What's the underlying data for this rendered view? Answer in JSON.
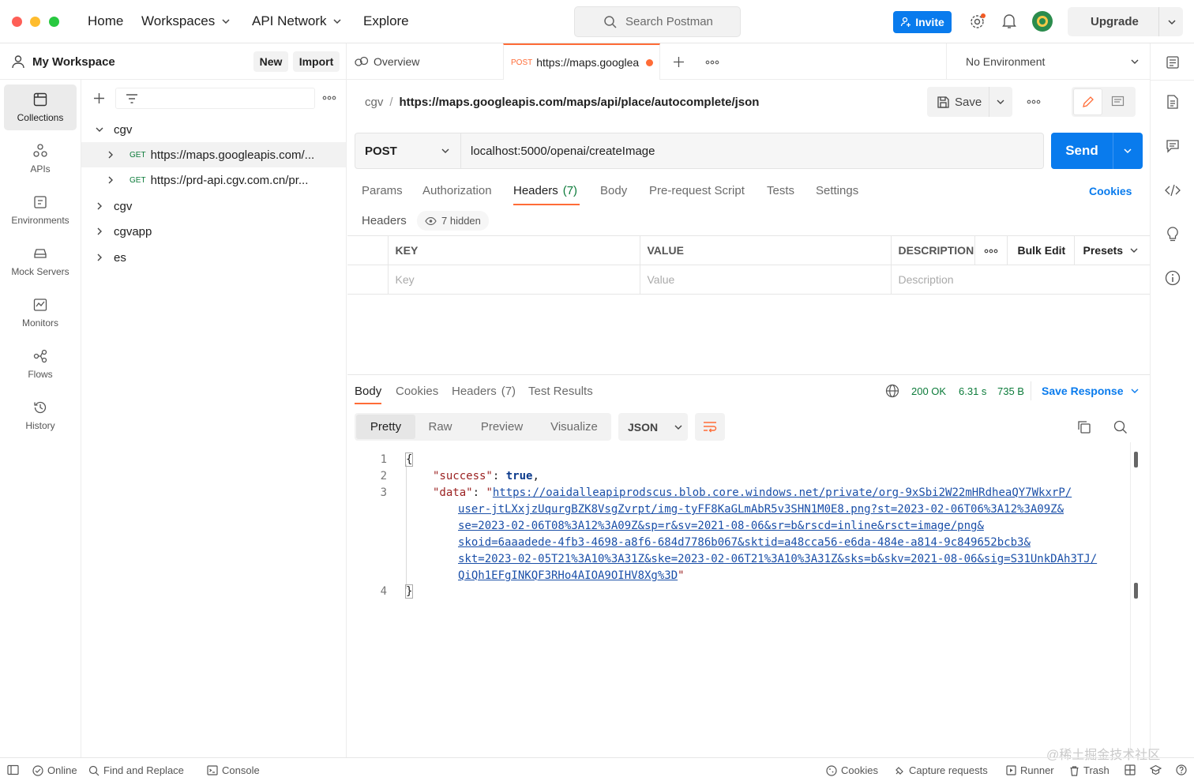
{
  "colors": {
    "accent": "#097bed",
    "brand": "#ff6c37",
    "success": "#0c7b3a",
    "link": "#1a4fa8"
  },
  "topnav": {
    "home": "Home",
    "workspaces": "Workspaces",
    "api_network": "API Network",
    "explore": "Explore",
    "search_placeholder": "Search Postman",
    "invite": "Invite",
    "upgrade": "Upgrade"
  },
  "workspace": {
    "name": "My Workspace",
    "new_label": "New",
    "import_label": "Import"
  },
  "rail": [
    {
      "label": "Collections",
      "icon": "collections-icon"
    },
    {
      "label": "APIs",
      "icon": "apis-icon"
    },
    {
      "label": "Environments",
      "icon": "environments-icon"
    },
    {
      "label": "Mock Servers",
      "icon": "mock-servers-icon"
    },
    {
      "label": "Monitors",
      "icon": "monitors-icon"
    },
    {
      "label": "Flows",
      "icon": "flows-icon"
    },
    {
      "label": "History",
      "icon": "history-icon"
    }
  ],
  "tree": [
    {
      "label": "cgv",
      "expanded": true
    },
    {
      "method": "GET",
      "label": "https://maps.googleapis.com/..."
    },
    {
      "method": "GET",
      "label": "https://prd-api.cgv.com.cn/pr..."
    },
    {
      "label": "cgv"
    },
    {
      "label": "cgvapp"
    },
    {
      "label": "es"
    }
  ],
  "tabs": {
    "overview": "Overview",
    "active_method": "POST",
    "active_title": "https://maps.googlea",
    "environment": "No Environment"
  },
  "breadcrumb": {
    "collection": "cgv",
    "separator": "/",
    "request": "https://maps.googleapis.com/maps/api/place/autocomplete/json"
  },
  "toolbar": {
    "save": "Save"
  },
  "request": {
    "method": "POST",
    "url": "localhost:5000/openai/createImage",
    "send": "Send",
    "tabs": [
      "Params",
      "Authorization",
      "Headers",
      "Body",
      "Pre-request Script",
      "Tests",
      "Settings"
    ],
    "headers_count": "(7)",
    "cookies": "Cookies",
    "headers_label": "Headers",
    "hidden": "7 hidden"
  },
  "headers_table": {
    "columns": [
      "KEY",
      "VALUE",
      "DESCRIPTION"
    ],
    "bulk_edit": "Bulk Edit",
    "presets": "Presets",
    "placeholders": [
      "Key",
      "Value",
      "Description"
    ]
  },
  "response": {
    "tabs": [
      "Body",
      "Cookies",
      "Headers",
      "Test Results"
    ],
    "headers_count": "(7)",
    "status": "200 OK",
    "time": "6.31 s",
    "size": "735 B",
    "save_response": "Save Response",
    "modes": [
      "Pretty",
      "Raw",
      "Preview",
      "Visualize"
    ],
    "format": "JSON",
    "code": {
      "line_numbers": [
        "1",
        "2",
        "3",
        "4"
      ],
      "open_brace": "{",
      "close_brace": "}",
      "success_key": "\"success\"",
      "success_value": "true",
      "data_key": "\"data\"",
      "url_lines": [
        "https://oaidalleapiprodscus.blob.core.windows.net/private/org-9xSbi2W22mHRdheaQY7WkxrP/",
        "user-jtLXxjzUqurgBZK8VsgZvrpt/img-tyFF8KaGLmAbR5v3SHN1M0E8.png?st=2023-02-06T06%3A12%3A09Z&",
        "se=2023-02-06T08%3A12%3A09Z&sp=r&sv=2021-08-06&sr=b&rscd=inline&rsct=image/png&",
        "skoid=6aaadede-4fb3-4698-a8f6-684d7786b067&sktid=a48cca56-e6da-484e-a814-9c849652bcb3&",
        "skt=2023-02-05T21%3A10%3A31Z&ske=2023-02-06T21%3A10%3A31Z&sks=b&skv=2021-08-06&sig=S31UnkDAh3TJ/",
        "QiQh1EFgINKQF3RHo4AIOA9OIHV8Xg%3D"
      ]
    }
  },
  "footer": {
    "online": "Online",
    "find_replace": "Find and Replace",
    "console": "Console",
    "cookies": "Cookies",
    "capture": "Capture requests",
    "runner": "Runner",
    "trash": "Trash"
  },
  "watermark": "@稀土掘金技术社区"
}
